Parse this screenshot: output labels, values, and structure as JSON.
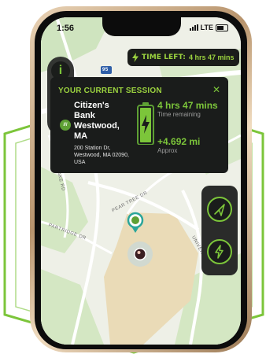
{
  "status_bar": {
    "time": "1:56",
    "carrier": "LTE"
  },
  "timer": {
    "label": "TIME LEFT:",
    "value": "4 hrs 47 mins"
  },
  "info_button": {
    "label": "i"
  },
  "session_card": {
    "title": "YOUR CURRENT SESSION",
    "close_icon": "close-icon",
    "station": {
      "name": "Citizen's Bank Westwood, MA",
      "address": "200 Station Dr, Westwood, MA 02090, USA",
      "badge": "ev-station-icon"
    },
    "time_remaining": {
      "value": "4 hrs 47 mins",
      "label": "Time remaining"
    },
    "distance": {
      "value": "+4.692 mi",
      "label": "Approx"
    }
  },
  "map": {
    "labels": {
      "route": "95",
      "pear_tree": "PEAR TREE DR",
      "partridge": "PARTRIDGE DR",
      "university": "UNIVERSITY AVE",
      "lake": "LAKE RD"
    },
    "pin_badge": "ev-station-pin-icon",
    "user_marker": "user-location-marker"
  },
  "side_controls": {
    "navigate_icon": "navigate-arrow-icon",
    "charge_icon": "lightning-icon"
  },
  "colors": {
    "accent": "#7cc53a",
    "accent_text": "#9bd23f",
    "card_bg": "#1a1c1b",
    "map_bg": "#eef0e7",
    "lot": "#eadbb7"
  }
}
